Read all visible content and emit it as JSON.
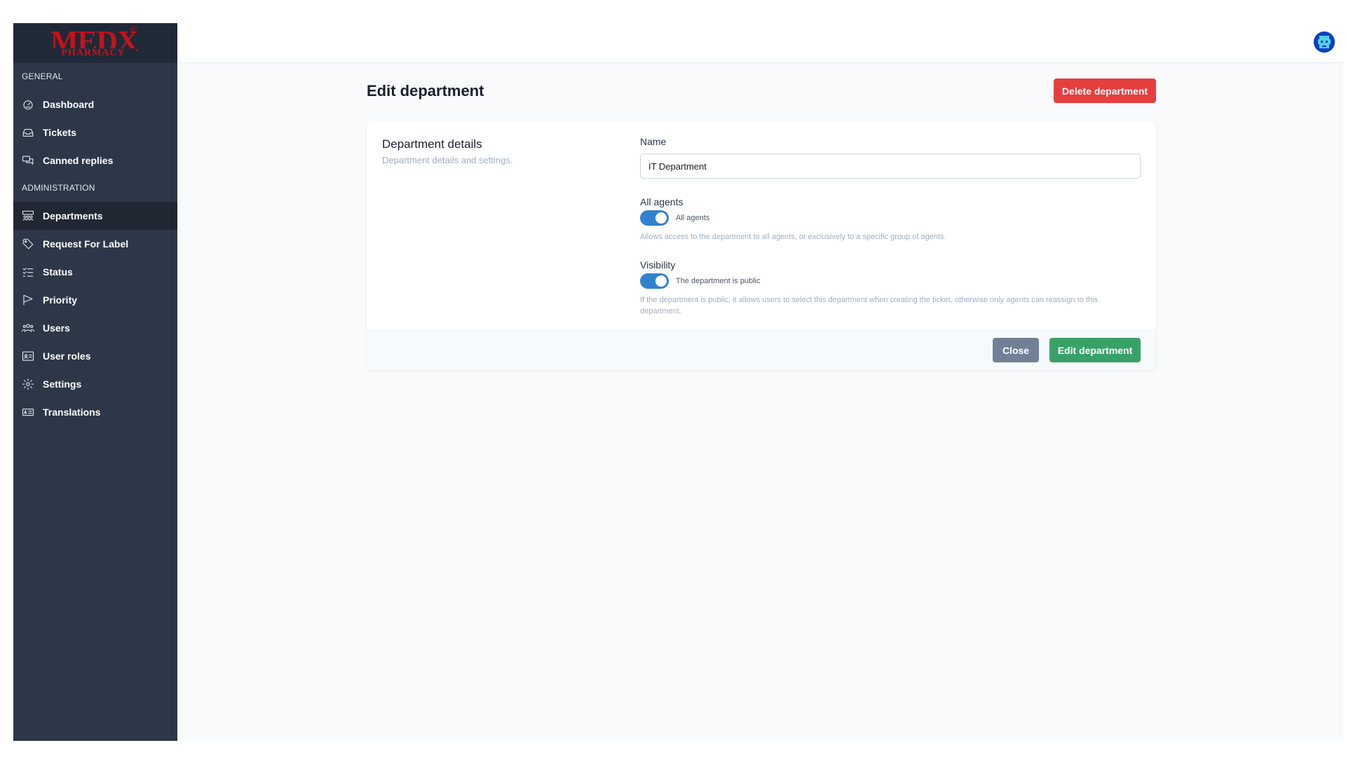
{
  "brand": {
    "logo_text": "MEDX",
    "logo_subtext": "PHARMACY",
    "logo_mark": "®",
    "color": "#c4121a"
  },
  "sidebar": {
    "general_title": "GENERAL",
    "general_items": [
      {
        "label": "Dashboard",
        "icon": "dashboard-icon"
      },
      {
        "label": "Tickets",
        "icon": "inbox-icon"
      },
      {
        "label": "Canned replies",
        "icon": "chat-bubbles-icon"
      }
    ],
    "admin_title": "ADMINISTRATION",
    "admin_items": [
      {
        "label": "Departments",
        "icon": "departments-icon",
        "active": true
      },
      {
        "label": "Request For Label",
        "icon": "tag-icon"
      },
      {
        "label": "Status",
        "icon": "list-check-icon"
      },
      {
        "label": "Priority",
        "icon": "flag-icon"
      },
      {
        "label": "Users",
        "icon": "users-icon"
      },
      {
        "label": "User roles",
        "icon": "id-card-icon"
      },
      {
        "label": "Settings",
        "icon": "gear-icon"
      },
      {
        "label": "Translations",
        "icon": "translate-icon"
      }
    ]
  },
  "header": {
    "avatar_icon": "user-avatar-icon"
  },
  "page": {
    "title": "Edit department",
    "delete_label": "Delete department"
  },
  "card": {
    "heading": "Department details",
    "subheading": "Department details and settings.",
    "name_label": "Name",
    "name_value": "IT Department",
    "all_agents_label": "All agents",
    "all_agents_toggle_label": "All agents",
    "all_agents_enabled": true,
    "all_agents_help": "Allows access to the department to all agents, or exclusively to a specific group of agents.",
    "visibility_label": "Visibility",
    "visibility_toggle_label": "The department is public",
    "visibility_enabled": true,
    "visibility_help": "If the department is public, it allows users to select this department when creating the ticket, otherwise only agents can reassign to this department.",
    "close_label": "Close",
    "submit_label": "Edit department"
  },
  "colors": {
    "sidebar_bg": "#2d3748",
    "delete": "#e53e3e",
    "submit": "#38a169",
    "close": "#718096",
    "toggle_on": "#3182ce"
  }
}
